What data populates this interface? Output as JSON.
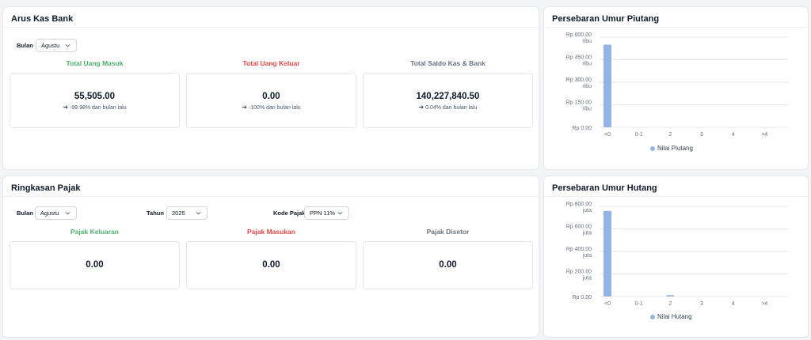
{
  "arus_kas": {
    "title": "Arus Kas Bank",
    "filter_label": "Bulan",
    "filter_value": "Agustu",
    "columns": [
      {
        "title": "Total Uang Masuk",
        "value": "55,505.00",
        "change": "-99.98% dari bulan lalu"
      },
      {
        "title": "Total Uang Keluar",
        "value": "0.00",
        "change": "-100% dari bulan lalu"
      },
      {
        "title": "Total Saldo Kas & Bank",
        "value": "140,227,840.50",
        "change": "0.04% dari bulan lalu"
      }
    ]
  },
  "pajak": {
    "title": "Ringkasan Pajak",
    "bulan_label": "Bulan",
    "bulan_value": "Agustu",
    "tahun_label": "Tahun",
    "tahun_value": "2025",
    "kode_label": "Kode Pajak",
    "kode_value": "PPN 11%",
    "columns": [
      {
        "title": "Pajak Keluaran",
        "value": "0.00"
      },
      {
        "title": "Pajak Masukan",
        "value": "0.00"
      },
      {
        "title": "Pajak Disetor",
        "value": "0.00"
      }
    ]
  },
  "colors": {
    "green": "#4caf6e",
    "red": "#ef4444",
    "gray": "#6b7280",
    "bar": "#94b4e6"
  },
  "chart_data": [
    {
      "type": "bar",
      "title": "Persebaran Umur Piutang",
      "categories": [
        "<0",
        "0-1",
        "2",
        "3",
        "4",
        ">4"
      ],
      "series": [
        {
          "name": "Nilai Piutang",
          "values": [
            550,
            0,
            0,
            0,
            0,
            0
          ]
        }
      ],
      "y_ticks": [
        {
          "value": 0,
          "label": "Rp 0.00",
          "label2": ""
        },
        {
          "value": 150,
          "label": "Rp 150.00",
          "label2": "ribu"
        },
        {
          "value": 300,
          "label": "Rp 300.00",
          "label2": "ribu"
        },
        {
          "value": 450,
          "label": "Rp 450.00",
          "label2": "ribu"
        },
        {
          "value": 600,
          "label": "Rp 600.00",
          "label2": "ribu"
        }
      ],
      "ylim": [
        0,
        600
      ],
      "unit": "ribu",
      "grid": true,
      "legend": "bottom"
    },
    {
      "type": "bar",
      "title": "Persebaran Umur Hutang",
      "categories": [
        "<0",
        "0-1",
        "2",
        "3",
        "4",
        ">4"
      ],
      "series": [
        {
          "name": "Nilai Hutang",
          "values": [
            760,
            0,
            12,
            0,
            0,
            0
          ]
        }
      ],
      "y_ticks": [
        {
          "value": 0,
          "label": "Rp 0.00",
          "label2": ""
        },
        {
          "value": 200,
          "label": "Rp 200.00",
          "label2": "juta"
        },
        {
          "value": 400,
          "label": "Rp 400.00",
          "label2": "juta"
        },
        {
          "value": 600,
          "label": "Rp 600.00",
          "label2": "juta"
        },
        {
          "value": 800,
          "label": "Rp 800.00",
          "label2": "juta"
        }
      ],
      "ylim": [
        0,
        800
      ],
      "unit": "juta",
      "grid": true,
      "legend": "bottom"
    }
  ]
}
